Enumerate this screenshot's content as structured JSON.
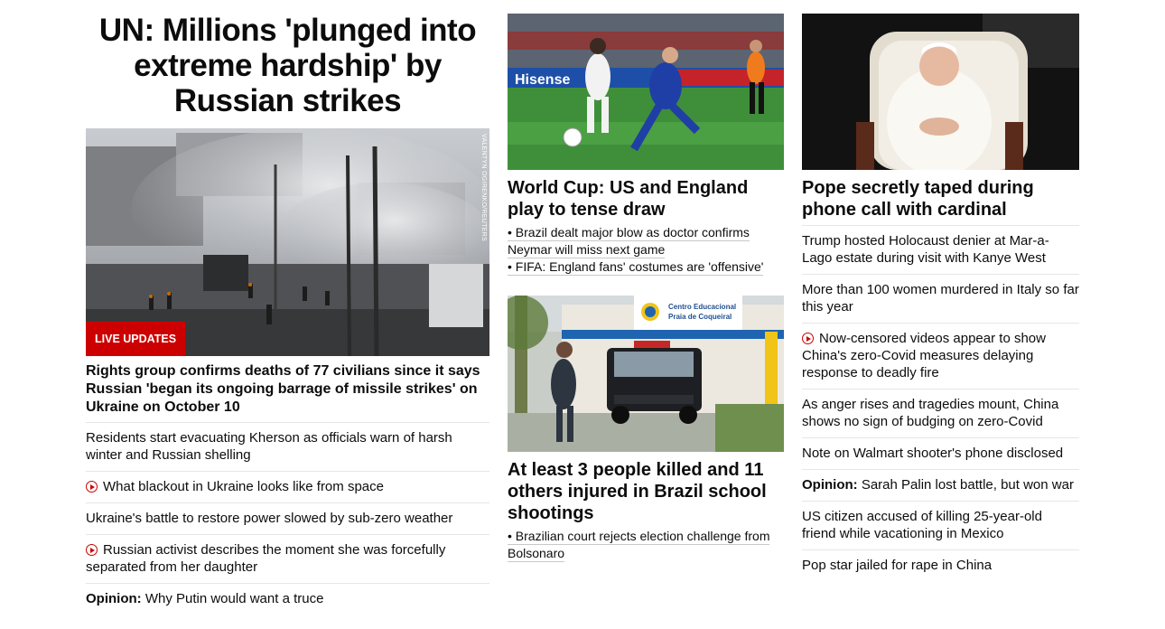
{
  "column1": {
    "headline": "UN: Millions 'plunged into extreme hardship' by Russian strikes",
    "photo_credit": "VALENTYN OGIRENKO/REUTERS",
    "live_badge": "LIVE UPDATES",
    "lead": "Rights group confirms deaths of 77 civilians since it says Russian 'began its ongoing barrage of missile strikes' on Ukraine on October 10",
    "items": [
      {
        "text": "Residents start evacuating Kherson as officials warn of harsh winter and Russian shelling",
        "video": false
      },
      {
        "text": "What blackout in Ukraine looks like from space",
        "video": true
      },
      {
        "text": "Ukraine's battle to restore power slowed by sub-zero weather",
        "video": false
      },
      {
        "text": "Russian activist describes the moment she was forcefully separated from her daughter",
        "video": true
      }
    ],
    "opinion_label": "Opinion:",
    "opinion_text": "Why Putin would want a truce"
  },
  "column2": {
    "card1_title": "World Cup: US and England play to tense draw",
    "card1_subs": [
      "• Brazil dealt major blow as doctor confirms Neymar will miss next game",
      "• FIFA: England fans' costumes are 'offensive'"
    ],
    "stadium_ad": "Hisense",
    "card2_sign_line1": "Centro Educacional",
    "card2_sign_line2": "Praia de Coqueiral",
    "card2_title": "At least 3 people killed and 11 others injured in Brazil school shootings",
    "card2_subs": [
      "• Brazilian court rejects election challenge from Bolsonaro"
    ]
  },
  "column3": {
    "card_title": "Pope secretly taped during phone call with cardinal",
    "items": [
      {
        "text": "Trump hosted Holocaust denier at Mar-a-Lago estate during visit with Kanye West",
        "video": false
      },
      {
        "text": "More than 100 women murdered in Italy so far this year",
        "video": false
      },
      {
        "text": "Now-censored videos appear to show China's zero-Covid measures delaying response to deadly fire",
        "video": true
      },
      {
        "text": "As anger rises and tragedies mount, China shows no sign of budging on zero-Covid",
        "video": false
      },
      {
        "text": "Note on Walmart shooter's phone disclosed",
        "video": false
      }
    ],
    "opinion_label": "Opinion:",
    "opinion_text": "Sarah Palin lost battle, but won war",
    "items2": [
      {
        "text": "US citizen accused of killing 25-year-old friend while vacationing in Mexico"
      },
      {
        "text": "Pop star jailed for rape in China"
      }
    ]
  },
  "colors": {
    "accent": "#cc0000",
    "text": "#0c0c0c",
    "divider": "#e6e6e6"
  }
}
